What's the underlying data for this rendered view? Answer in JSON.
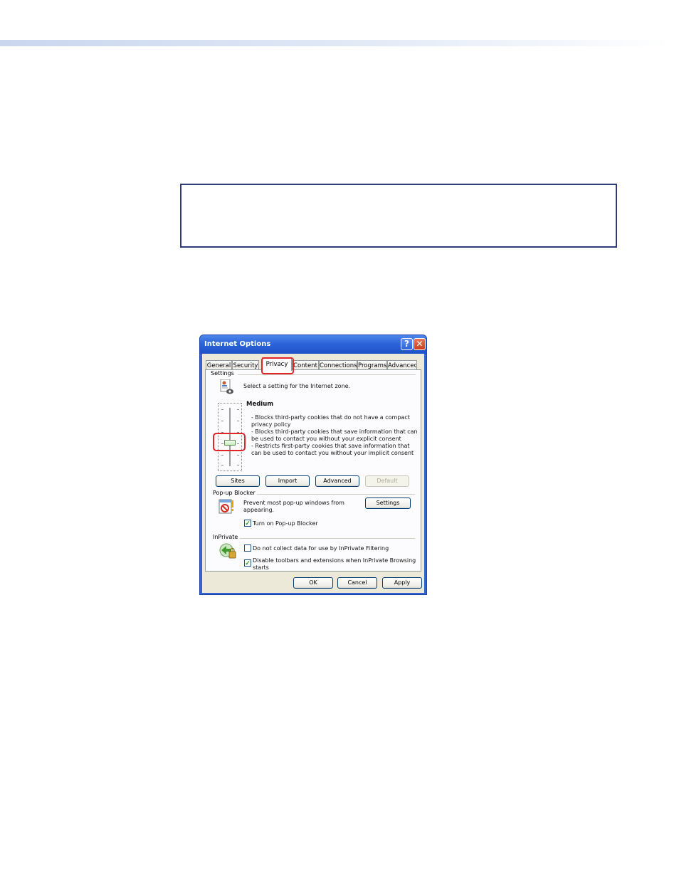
{
  "dialog": {
    "title": "Internet Options",
    "help_glyph": "?",
    "close_glyph": "✕",
    "tabs": [
      "General",
      "Security",
      "Privacy",
      "Content",
      "Connections",
      "Programs",
      "Advanced"
    ],
    "active_tab": "Privacy"
  },
  "settings": {
    "group_label": "Settings",
    "zone_text": "Select a setting for the Internet zone.",
    "level_title": "Medium",
    "desc_lines": [
      "- Blocks third-party cookies that do not have a compact",
      "privacy policy",
      "- Blocks third-party cookies that save information that can",
      "be used to contact you without your explicit consent",
      "- Restricts first-party cookies that save information that",
      "can be used to contact you without your implicit consent"
    ],
    "slider_level": "Medium",
    "buttons": {
      "sites": "Sites",
      "import": "Import",
      "advanced": "Advanced",
      "default": "Default"
    }
  },
  "popup": {
    "group_label": "Pop-up Blocker",
    "desc_lines": [
      "Prevent most pop-up windows from",
      "appearing."
    ],
    "settings_button": "Settings",
    "checkbox_label": "Turn on Pop-up Blocker",
    "checked": true
  },
  "inprivate": {
    "group_label": "InPrivate",
    "filter_label": "Do not collect data for use by InPrivate Filtering",
    "filter_checked": false,
    "toolbar_lines": [
      "Disable toolbars and extensions when InPrivate Browsing",
      "starts"
    ],
    "toolbar_checked": true
  },
  "footer": {
    "ok": "OK",
    "cancel": "Cancel",
    "apply": "Apply"
  },
  "colors": {
    "accent_highlight": "#e0242a",
    "title_bar": "#2c64d9",
    "note_border": "#2e3a7a"
  }
}
